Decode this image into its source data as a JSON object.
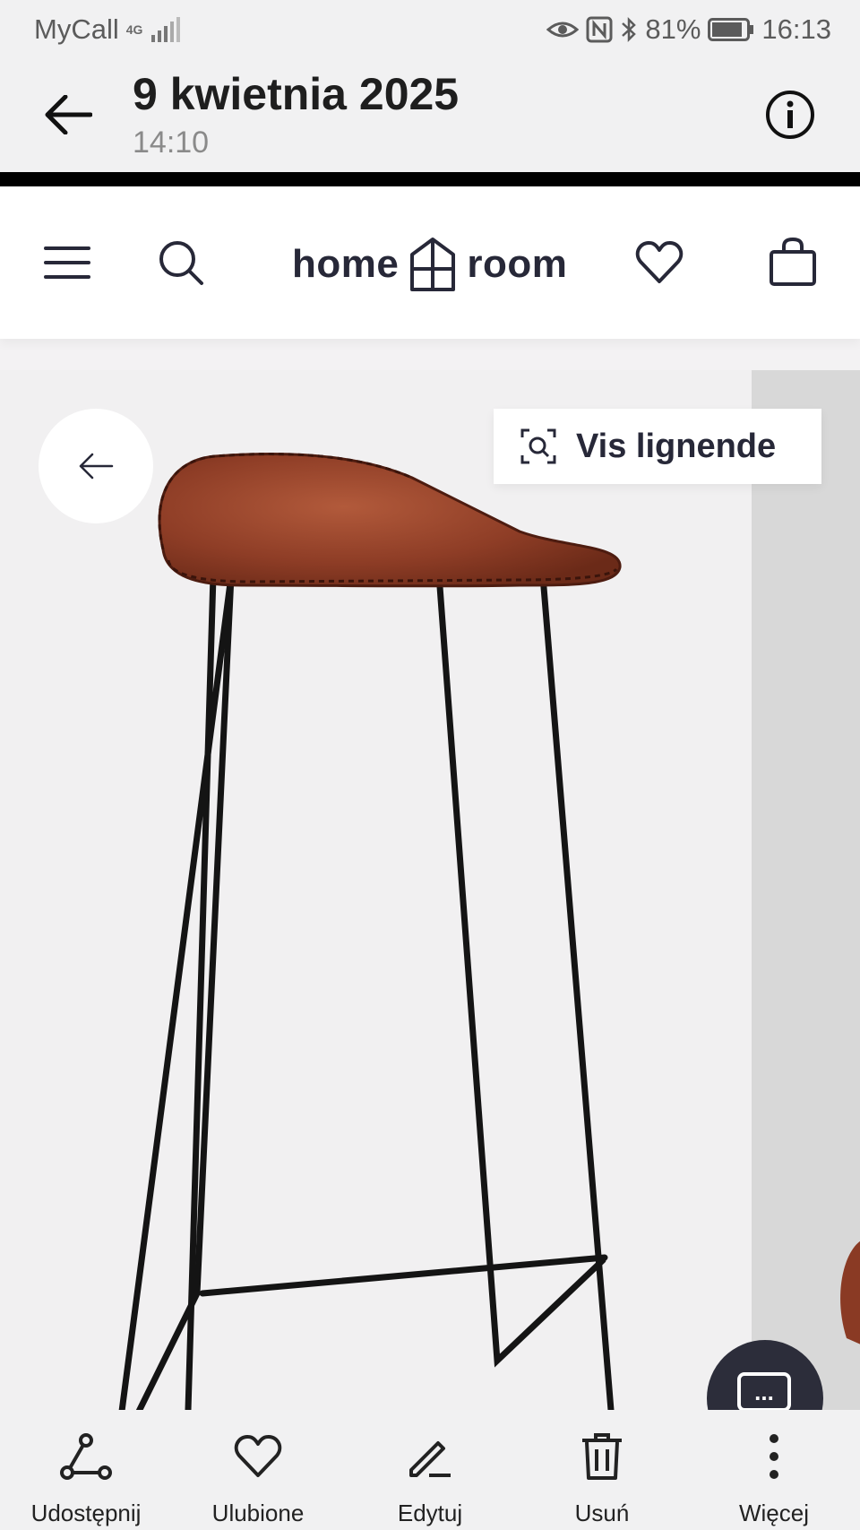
{
  "status_bar": {
    "carrier": "MyCall",
    "network": "4G",
    "battery": "81%",
    "time": "16:13"
  },
  "header": {
    "date": "9 kwietnia 2025",
    "time": "14:10"
  },
  "screenshot": {
    "logo_left": "home",
    "logo_right": "room",
    "view_similar_label": "Vis lignende",
    "chat_icon_text": "..."
  },
  "bottom_bar": {
    "items": [
      {
        "label": "Udostępnij",
        "icon": "share-icon"
      },
      {
        "label": "Ulubione",
        "icon": "heart-icon"
      },
      {
        "label": "Edytuj",
        "icon": "edit-icon"
      },
      {
        "label": "Usuń",
        "icon": "trash-icon"
      },
      {
        "label": "Więcej",
        "icon": "more-icon"
      }
    ]
  },
  "colors": {
    "seat": "#8a3a24",
    "legs": "#111111",
    "brand": "#272838"
  }
}
